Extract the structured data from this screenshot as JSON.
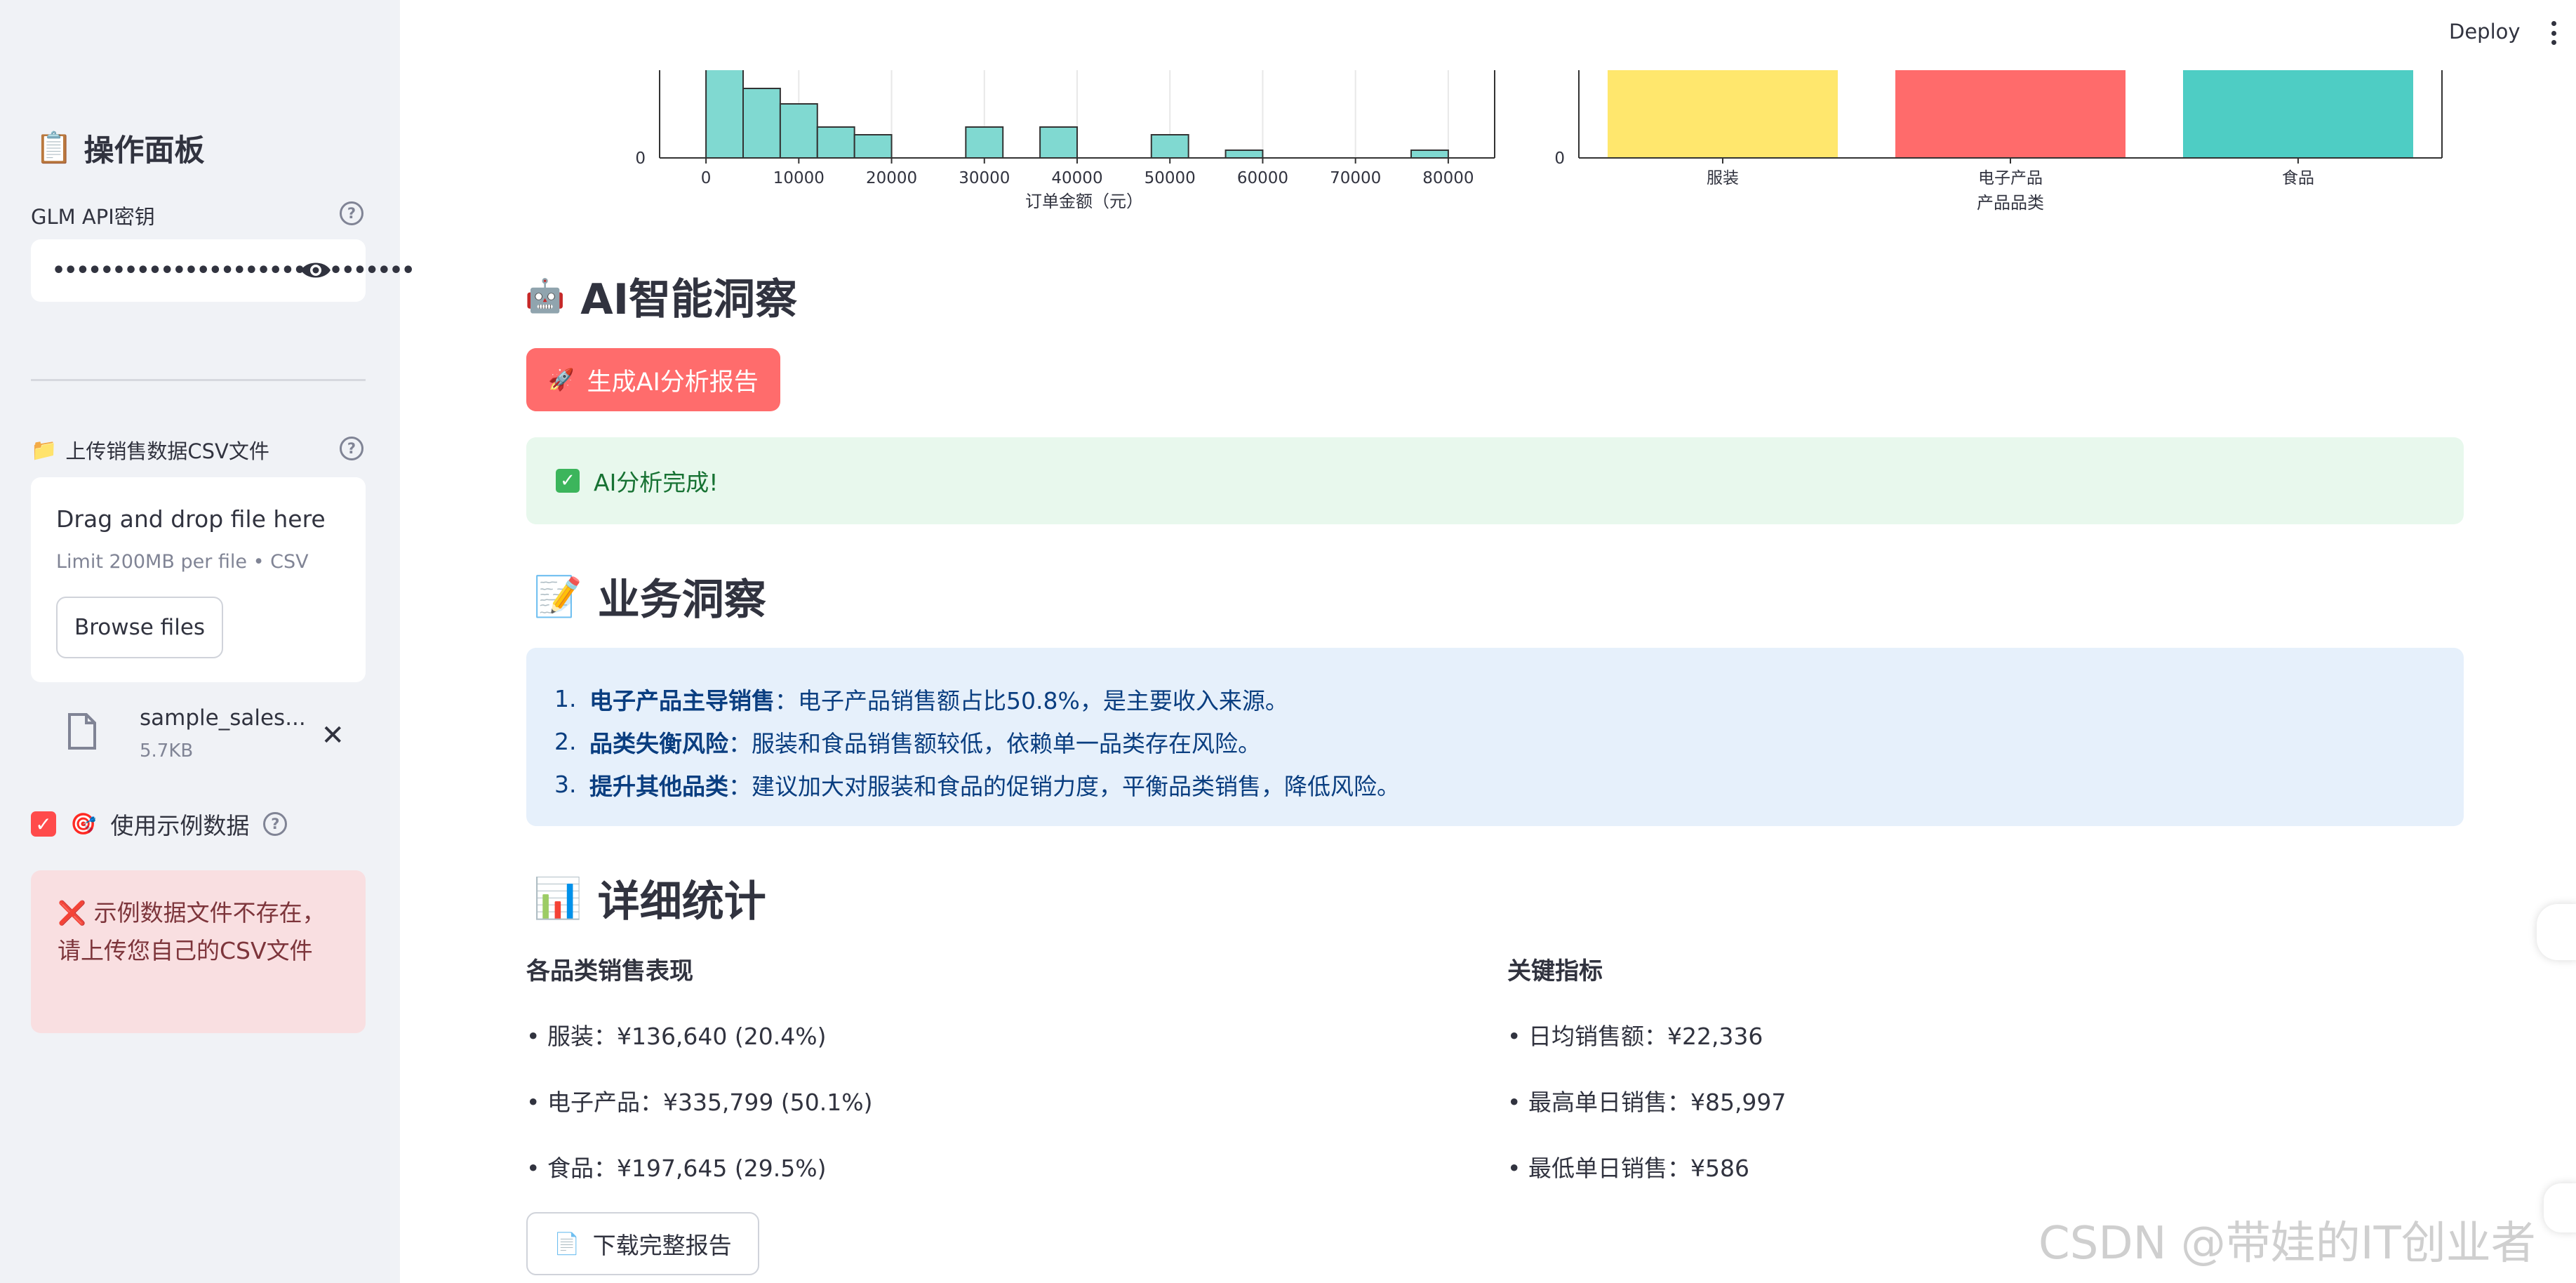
{
  "sidebar": {
    "title": "操作面板",
    "api_key_label": "GLM API密钥",
    "api_key_value": "••••••••••••••••••••••••••••••",
    "upload_label": "上传销售数据CSV文件",
    "dropzone_title": "Drag and drop file here",
    "dropzone_limit": "Limit 200MB per file • CSV",
    "browse_label": "Browse files",
    "file_name": "sample_sales...",
    "file_size": "5.7KB",
    "sample_checkbox_label": "使用示例数据",
    "error_text": "❌ 示例数据文件不存在，请上传您自己的CSV文件"
  },
  "header": {
    "deploy_label": "Deploy"
  },
  "chart_data": [
    {
      "type": "bar",
      "xlabel": "订单金额（元）",
      "x_ticks": [
        "0",
        "10000",
        "20000",
        "30000",
        "40000",
        "50000",
        "60000",
        "70000",
        "80000"
      ],
      "y_tick": "0",
      "bins": [
        {
          "start": 0,
          "end": 4000,
          "value": 14
        },
        {
          "start": 4000,
          "end": 8000,
          "value": 9
        },
        {
          "start": 8000,
          "end": 12000,
          "value": 7
        },
        {
          "start": 12000,
          "end": 16000,
          "value": 4
        },
        {
          "start": 16000,
          "end": 20000,
          "value": 3
        },
        {
          "start": 28000,
          "end": 32000,
          "value": 4
        },
        {
          "start": 36000,
          "end": 40000,
          "value": 4
        },
        {
          "start": 48000,
          "end": 52000,
          "value": 3
        },
        {
          "start": 56000,
          "end": 60000,
          "value": 1
        },
        {
          "start": 76000,
          "end": 80000,
          "value": 1
        }
      ],
      "color": "#80d9d1"
    },
    {
      "type": "bar",
      "xlabel": "产品品类",
      "categories": [
        "服装",
        "电子产品",
        "食品"
      ],
      "y_tick": "0",
      "colors": [
        "#ffe76d",
        "#ff6b6b",
        "#4ecdc4"
      ]
    }
  ],
  "ai_section": {
    "title": "AI智能洞察",
    "generate_button": "生成AI分析报告",
    "success_text": "AI分析完成!"
  },
  "insights": {
    "title": "业务洞察",
    "items": [
      {
        "num": "1.",
        "bold": "电子产品主导销售",
        "text": "：电子产品销售额占比50.8%，是主要收入来源。"
      },
      {
        "num": "2.",
        "bold": "品类失衡风险",
        "text": "：服装和食品销售额较低，依赖单一品类存在风险。"
      },
      {
        "num": "3.",
        "bold": "提升其他品类",
        "text": "：建议加大对服装和食品的促销力度，平衡品类销售，降低风险。"
      }
    ]
  },
  "stats": {
    "title": "详细统计",
    "category_title": "各品类销售表现",
    "category_items": [
      "• 服装：¥136,640 (20.4%)",
      "• 电子产品：¥335,799 (50.1%)",
      "• 食品：¥197,645 (29.5%)"
    ],
    "kpi_title": "关键指标",
    "kpi_items": [
      "• 日均销售额：¥22,336",
      "• 最高单日销售：¥85,997",
      "• 最低单日销售：¥586"
    ],
    "download_button": "下载完整报告"
  },
  "watermark": "CSDN @带娃的IT创业者"
}
